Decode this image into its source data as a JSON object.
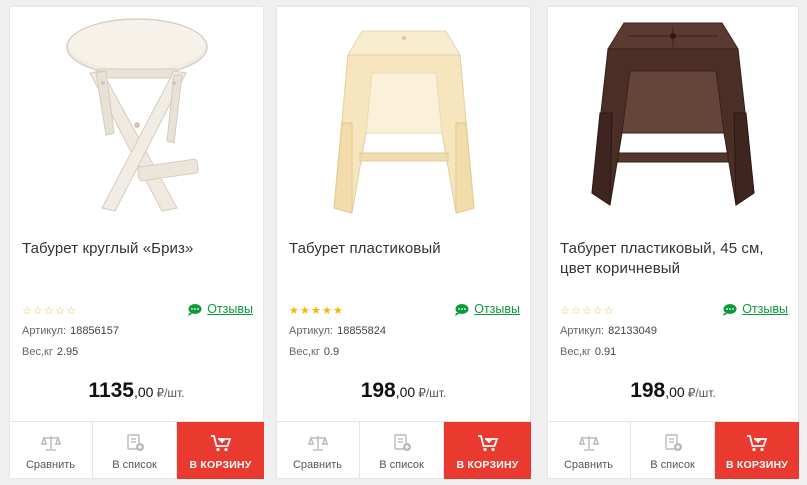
{
  "products": [
    {
      "title": "Табурет круглый «Бриз»",
      "rating": 0,
      "reviews_label": "Отзывы",
      "sku_label": "Артикул:",
      "sku": "18856157",
      "weight_label": "Вес,кг",
      "weight": "2.95",
      "price_main": "1135",
      "price_cents": ",00",
      "price_unit": "₽/шт.",
      "compare_label": "Сравнить",
      "list_label": "В список",
      "cart_label": "В КОРЗИНУ",
      "image_icon": "round-wooden-folding-stool"
    },
    {
      "title": "Табурет пластиковый",
      "rating": 5,
      "reviews_label": "Отзывы",
      "sku_label": "Артикул:",
      "sku": "18855824",
      "weight_label": "Вес,кг",
      "weight": "0.9",
      "price_main": "198",
      "price_cents": ",00",
      "price_unit": "₽/шт.",
      "compare_label": "Сравнить",
      "list_label": "В список",
      "cart_label": "В КОРЗИНУ",
      "image_icon": "beige-plastic-stool"
    },
    {
      "title": "Табурет пластиковый, 45 см, цвет коричневый",
      "rating": 0,
      "reviews_label": "Отзывы",
      "sku_label": "Артикул:",
      "sku": "82133049",
      "weight_label": "Вес,кг",
      "weight": "0.91",
      "price_main": "198",
      "price_cents": ",00",
      "price_unit": "₽/шт.",
      "compare_label": "Сравнить",
      "list_label": "В список",
      "cart_label": "В КОРЗИНУ",
      "image_icon": "brown-plastic-stool"
    }
  ],
  "colors": {
    "accent_red": "#ea3a2f",
    "reviews_green": "#0a9b3c",
    "star_yellow": "#f7b500",
    "stool_beige": "#f6e7c4",
    "stool_brown": "#4b2e26",
    "stool_white_wood": "#f1ece3"
  }
}
